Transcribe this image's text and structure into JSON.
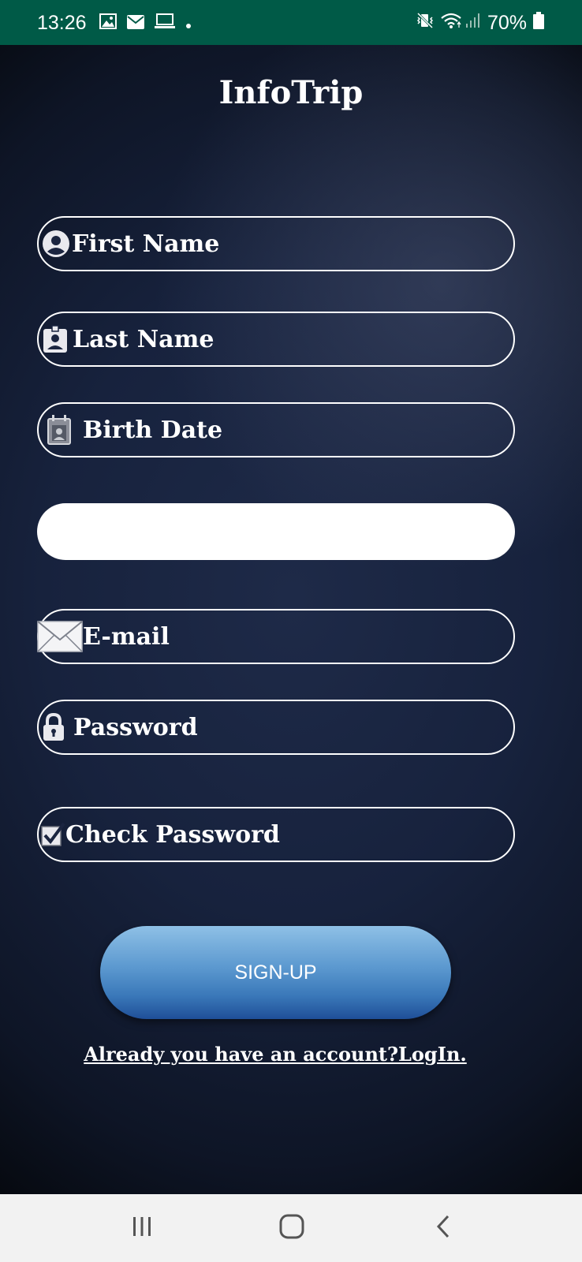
{
  "status_bar": {
    "time": "13:26",
    "battery": "70%",
    "icons_left": [
      "image-icon",
      "mail-icon",
      "laptop-icon",
      "dot-icon"
    ],
    "icons_right": [
      "vibrate-icon",
      "wifi-icon",
      "signal-icon",
      "battery-icon"
    ]
  },
  "app": {
    "title": "InfoTrip"
  },
  "form": {
    "first_name": {
      "label": "First Name",
      "icon": "user-circle-icon"
    },
    "last_name": {
      "label": "Last Name",
      "icon": "badge-icon"
    },
    "birth_date": {
      "label": "Birth Date",
      "icon": "calendar-icon"
    },
    "blank_value": "",
    "email": {
      "label": "E-mail",
      "icon": "envelope-icon"
    },
    "password": {
      "label": "Password",
      "icon": "lock-icon"
    },
    "check_password": {
      "label": "Check Password",
      "icon": "checkbox-icon"
    }
  },
  "actions": {
    "signup_label": "SIGN-UP",
    "login_link": "Already you have an account?LogIn."
  },
  "colors": {
    "status_bar": "#005a47",
    "button_top": "#8ec0e6",
    "button_bottom": "#1f4f98",
    "nav_bar": "#f2f2f2"
  },
  "nav": {
    "buttons": [
      "recents-icon",
      "home-icon",
      "back-icon"
    ]
  }
}
